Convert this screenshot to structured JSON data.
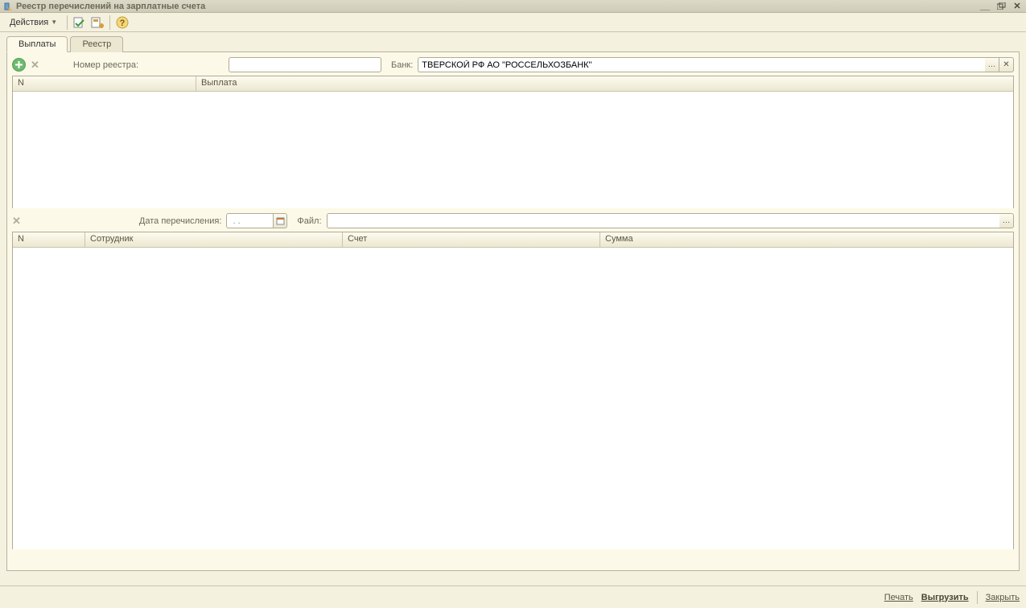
{
  "window": {
    "title": "Реестр перечислений на зарплатные счета"
  },
  "toolbar": {
    "actions_label": "Действия"
  },
  "tabs": {
    "payments": "Выплаты",
    "registry": "Реестр",
    "active": "payments"
  },
  "filter": {
    "registry_number_label": "Номер реестра:",
    "registry_number_value": "",
    "bank_label": "Банк:",
    "bank_value": "ТВЕРСКОЙ РФ АО \"РОССЕЛЬХОЗБАНК\""
  },
  "table1": {
    "columns": {
      "n": "N",
      "payment": "Выплата"
    },
    "rows": []
  },
  "mid": {
    "transfer_date_label": "Дата перечисления:",
    "transfer_date_value": " . .",
    "file_label": "Файл:",
    "file_value": ""
  },
  "table2": {
    "columns": {
      "n": "N",
      "employee": "Сотрудник",
      "account": "Счет",
      "sum": "Сумма"
    },
    "rows": []
  },
  "footer": {
    "print": "Печать",
    "export": "Выгрузить",
    "close": "Закрыть"
  }
}
